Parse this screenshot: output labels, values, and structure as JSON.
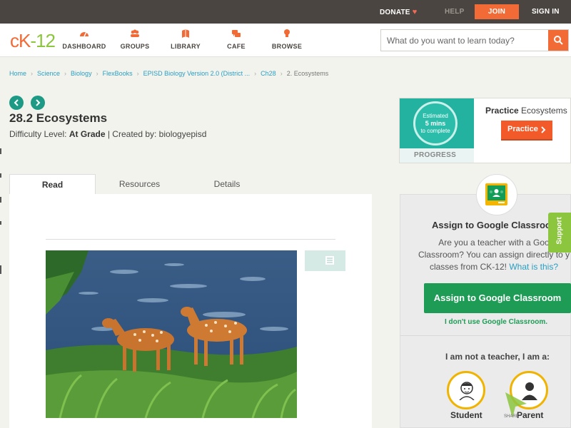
{
  "topbar": {
    "donate": "DONATE",
    "help": "HELP",
    "join": "JOIN",
    "signin": "SIGN IN"
  },
  "logo": {
    "c": "c",
    "k": "K",
    "dash": "-",
    "num": "12"
  },
  "nav": {
    "dashboard": "DASHBOARD",
    "groups": "GROUPS",
    "library": "LIBRARY",
    "cafe": "CAFE",
    "browse": "BROWSE"
  },
  "search": {
    "placeholder": "What do you want to learn today?"
  },
  "breadcrumb": [
    "Home",
    "Science",
    "Biology",
    "FlexBooks",
    "EPISD Biology Version 2.0 (District ...",
    "Ch28",
    "2. Ecosystems"
  ],
  "page": {
    "title": "28.2 Ecosystems",
    "difficulty_label": "Difficulty Level:",
    "difficulty_value": "At Grade",
    "created_by": "| Created by: biologyepisd"
  },
  "tabs": {
    "read": "Read",
    "resources": "Resources",
    "details": "Details"
  },
  "practice": {
    "est_line1": "Estimated",
    "est_line2": "5 mins",
    "est_line3": "to complete",
    "progress": "PROGRESS",
    "title_bold": "Practice",
    "title_rest": "Ecosystems",
    "button": "Practice"
  },
  "classroom": {
    "heading": "Assign to Google Classroo",
    "desc1": "Are you a teacher with a Goo",
    "desc2": "Classroom? You can assign directly to y",
    "desc3": "classes from CK-12!",
    "desc_link": "What is this?",
    "button": "Assign to Google Classroom",
    "no_use": "I don't use Google Classroom.",
    "not_teacher": "I am not a teacher, I am a:",
    "student": "Student",
    "parent": "Parent"
  },
  "support": "Support",
  "share": "SHARE",
  "colors": {
    "brand_orange": "#f26a36",
    "brand_green": "#8cc63e",
    "teal": "#1d9a85",
    "classroom_green": "#1e9c55",
    "link_blue": "#2b9ec1"
  }
}
